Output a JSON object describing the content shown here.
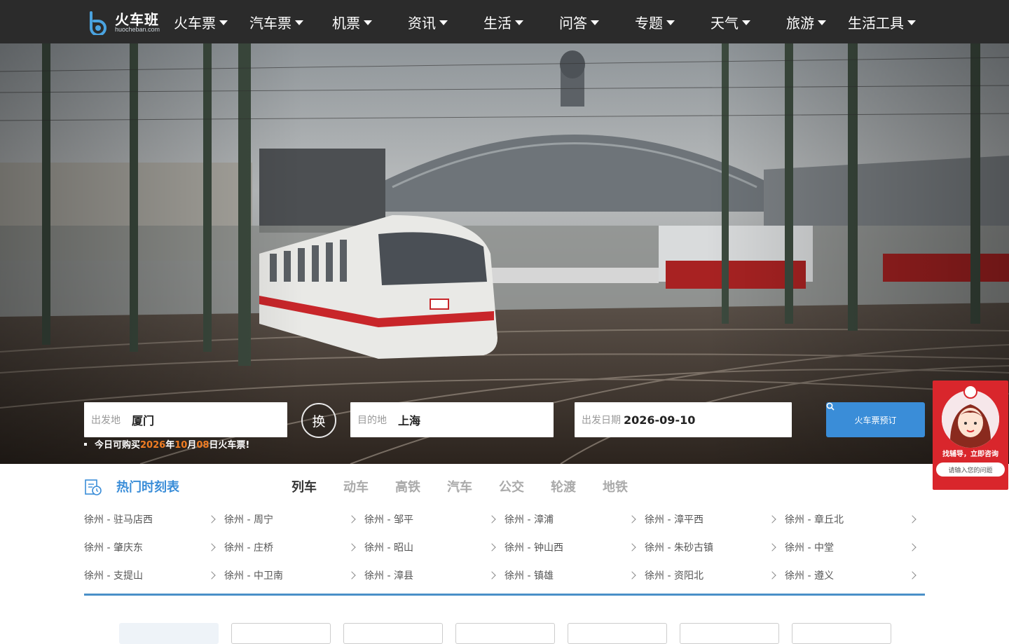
{
  "nav": {
    "logo_cn": "火车班",
    "logo_en": "huocheban.com",
    "items": [
      {
        "label": "火车票"
      },
      {
        "label": "汽车票"
      },
      {
        "label": "机票"
      },
      {
        "label": "资讯"
      },
      {
        "label": "生活"
      },
      {
        "label": "问答"
      },
      {
        "label": "专题"
      },
      {
        "label": "天气"
      },
      {
        "label": "旅游"
      },
      {
        "label": "生活工具"
      }
    ]
  },
  "search": {
    "from_label": "出发地",
    "from_value": "厦门",
    "swap_label": "换",
    "to_label": "目的地",
    "to_value": "上海",
    "date_label": "出发日期",
    "date_value": "2026-09-10",
    "button_label": "火车票预订",
    "notice": {
      "prefix": "今日可购买",
      "year": "2026",
      "year_unit": "年",
      "month": "10",
      "month_unit": "月",
      "day": "08",
      "suffix": "日火车票!"
    }
  },
  "consult": {
    "message": "找辅导，立即咨询",
    "input_placeholder": "请输入您的问题"
  },
  "timetable": {
    "title": "热门时刻表",
    "tabs": [
      {
        "label": "列车",
        "active": true
      },
      {
        "label": "动车",
        "active": false
      },
      {
        "label": "高铁",
        "active": false
      },
      {
        "label": "汽车",
        "active": false
      },
      {
        "label": "公交",
        "active": false
      },
      {
        "label": "轮渡",
        "active": false
      },
      {
        "label": "地铁",
        "active": false
      }
    ],
    "routes": [
      [
        "徐州 - 驻马店西",
        "徐州 - 周宁",
        "徐州 - 邹平",
        "徐州 - 漳浦",
        "徐州 - 漳平西",
        "徐州 - 章丘北"
      ],
      [
        "徐州 - 肇庆东",
        "徐州 - 庄桥",
        "徐州 - 昭山",
        "徐州 - 钟山西",
        "徐州 - 朱砂古镇",
        "徐州 - 中堂"
      ],
      [
        "徐州 - 支提山",
        "徐州 - 中卫南",
        "徐州 - 漳县",
        "徐州 - 镇雄",
        "徐州 - 资阳北",
        "徐州 - 遵义"
      ]
    ]
  },
  "colors": {
    "nav_bg": "#2b2b2b",
    "accent": "#3a8dd8",
    "highlight": "#f07c22",
    "consult_red": "#d9262c"
  }
}
